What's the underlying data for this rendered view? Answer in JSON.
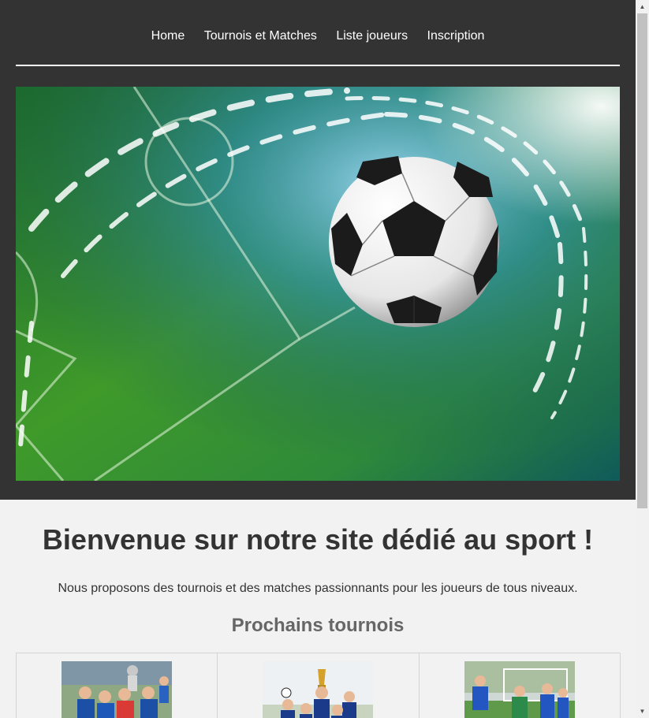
{
  "nav": {
    "items": [
      {
        "label": "Home"
      },
      {
        "label": "Tournois et Matches"
      },
      {
        "label": "Liste joueurs"
      },
      {
        "label": "Inscription"
      }
    ]
  },
  "hero": {
    "icon": "soccer-ball-on-pitch"
  },
  "main": {
    "title": "Bienvenue sur notre site dédié au sport !",
    "intro": "Nous proposons des tournois et des matches passionnants pour les joueurs de tous niveaux.",
    "tournaments_heading": "Prochains tournois"
  },
  "colors": {
    "header_bg": "#333333",
    "page_bg": "#f2f2f2",
    "text": "#333333",
    "heading2": "#666666"
  }
}
